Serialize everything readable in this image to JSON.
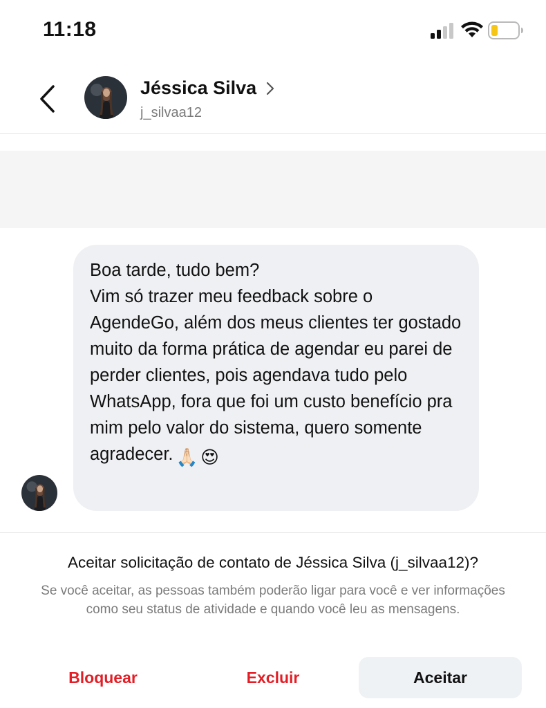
{
  "status_bar": {
    "time": "11:18",
    "signal_icon": "cellular-signal-icon",
    "wifi_icon": "wifi-icon",
    "battery_icon": "battery-low-icon",
    "battery_level": 0.25,
    "battery_color": "#f5c518"
  },
  "header": {
    "back_icon": "chevron-left-icon",
    "contact_name": "Jéssica Silva",
    "contact_handle": "j_silvaa12",
    "chevron_icon": "chevron-right-icon",
    "avatar_icon": "profile-photo"
  },
  "message": {
    "text": "Boa tarde, tudo bem?\nVim só trazer meu feedback sobre o AgendeGo, além dos meus clientes ter gostado muito da forma prática de agendar eu parei de perder clientes, pois agendava tudo pelo WhatsApp, fora que foi um custo benefício pra mim pelo valor do sistema, quero somente agradecer.",
    "emojis": [
      "🙏🏻",
      "😍"
    ]
  },
  "request": {
    "title": "Aceitar solicitação de contato de Jéssica Silva (j_silvaa12)?",
    "description": "Se você aceitar, as pessoas também poderão ligar para você e ver informações como seu status de atividade e quando você leu as mensagens.",
    "block_label": "Bloquear",
    "delete_label": "Excluir",
    "accept_label": "Aceitar"
  },
  "colors": {
    "danger": "#e41e26",
    "bubble": "#eff0f3",
    "secondary_text": "#7b7b7b"
  }
}
